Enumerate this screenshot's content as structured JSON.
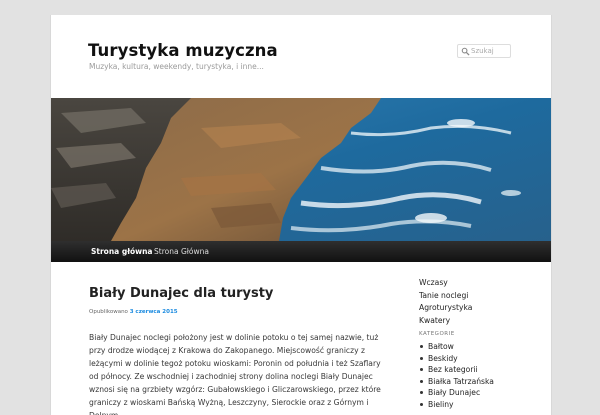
{
  "site": {
    "title": "Turystyka muzyczna",
    "description": "Muzyka, kultura, weekendy, turystyka, i inne..."
  },
  "search": {
    "placeholder": "Szukaj",
    "icon": "search-icon"
  },
  "nav": {
    "items": [
      {
        "label": "Strona główna",
        "active": true
      },
      {
        "label": "Strona Główna",
        "active": false
      }
    ]
  },
  "post": {
    "title": "Biały Dunajec dla turysty",
    "meta_prefix": "Opublikowano",
    "date": "3 czerwca 2015",
    "body": "Biały Dunajec noclegi położony jest w dolinie potoku o tej samej nazwie, tuż przy drodze wiodącej z Krakowa do Zakopanego. Miejscowość graniczy z leżącymi w dolinie tegoż potoku wioskami: Poronin od południa i też Szaflary od północy. Ze wschodniej i zachodniej strony dolina noclegi Biały Dunajec wznosi się na grzbiety wzgórz: Gubałowskiego i Gliczarowskiego, przez które graniczy z wioskami Bańską Wyżną, Leszczyny, Sierockie oraz z Górnym i Dolnym"
  },
  "sidebar": {
    "links": [
      "Wczasy",
      "Tanie noclegi",
      "Agroturystyka",
      "Kwatery"
    ],
    "categories_heading": "KATEGORIE",
    "categories": [
      "Bałtow",
      "Beskidy",
      "Bez kategorii",
      "Białka Tatrzańska",
      "Biały Dunajec",
      "Bieliny"
    ]
  }
}
